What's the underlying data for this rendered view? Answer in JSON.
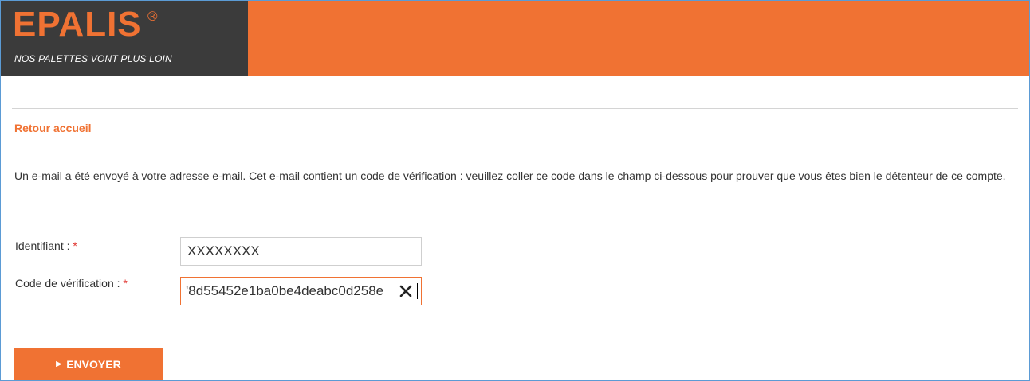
{
  "header": {
    "logo": "EPALIS",
    "logo_mark": "®",
    "tagline": "NOS PALETTES VONT PLUS LOIN",
    "colors": {
      "brand_orange": "#f07233",
      "logo_bg": "#3b3b3b"
    }
  },
  "nav": {
    "back_link": "Retour accueil"
  },
  "message": {
    "text": "Un e-mail a été envoyé à votre adresse e-mail. Cet e-mail contient un code de vérification : veuillez coller ce code dans le champ ci-dessous pour prouver que vous êtes bien le détenteur de ce compte."
  },
  "form": {
    "username": {
      "label": "Identifiant :",
      "required_mark": "*",
      "value": "XXXXXXXX"
    },
    "code": {
      "label": "Code de vérification :",
      "required_mark": "*",
      "value": "'8d55452e1ba0be4deabc0d258e",
      "clear_icon": "close-icon"
    },
    "submit": {
      "icon": "caret-right-icon",
      "icon_glyph": "▶",
      "label": "ENVOYER"
    }
  }
}
